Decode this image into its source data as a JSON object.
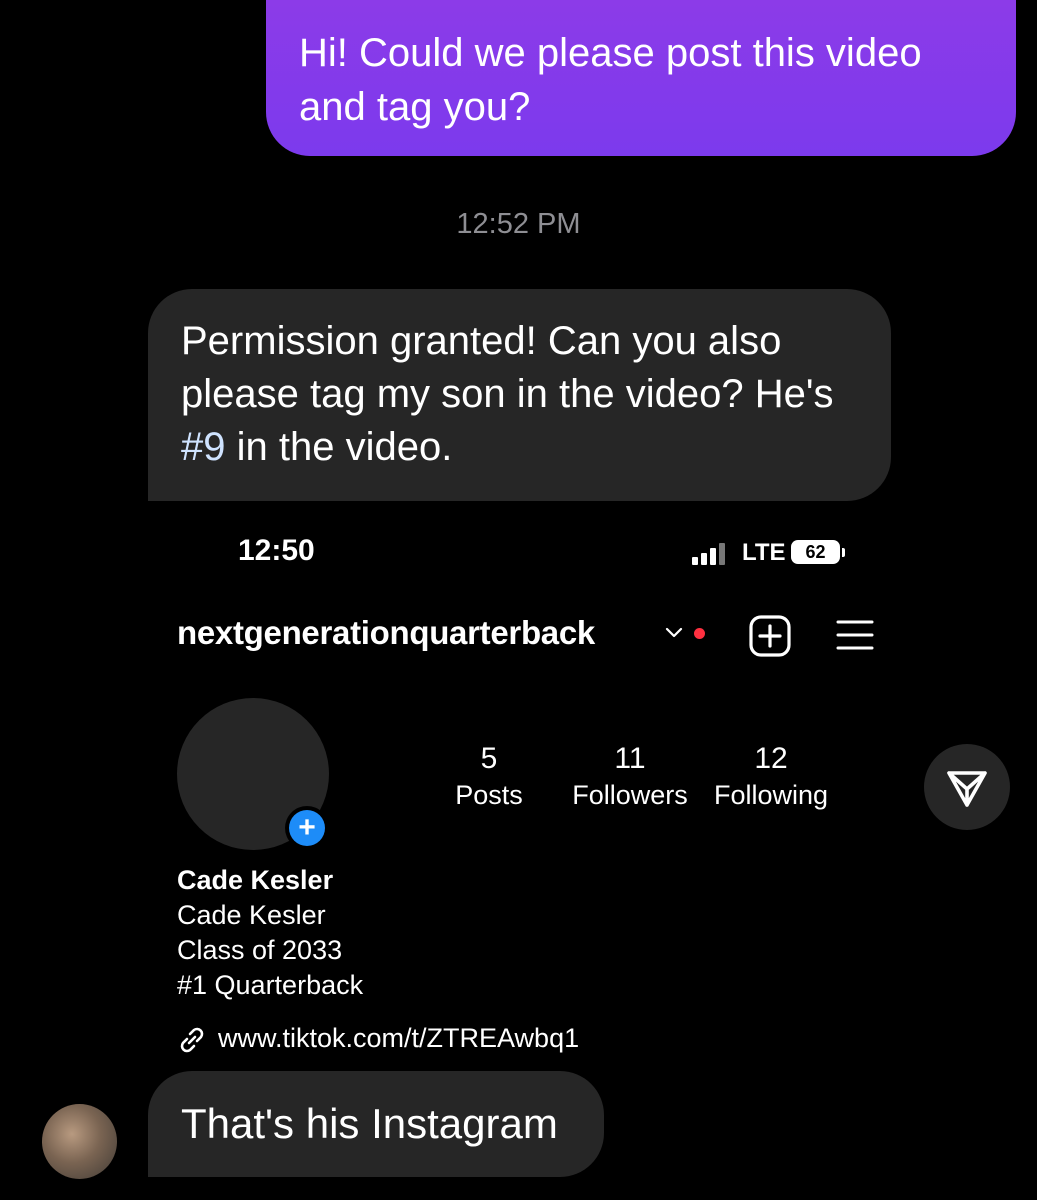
{
  "messages": {
    "outgoing": "Hi! Could we please post this video and tag you?",
    "timestamp": "12:52 PM",
    "incoming_parts": [
      "Permission granted!   Can you also please tag my son in the video? He's ",
      "#9",
      " in the video."
    ],
    "last": "That's his Instagram"
  },
  "shared_screenshot": {
    "status_time": "12:50",
    "network": "LTE",
    "battery": "62",
    "username": "nextgenerationquarterback",
    "stats": [
      {
        "value": "5",
        "label": "Posts"
      },
      {
        "value": "11",
        "label": "Followers"
      },
      {
        "value": "12",
        "label": "Following"
      }
    ],
    "profile_name": "Cade Kesler",
    "bio_lines": [
      "Cade Kesler",
      "Class of 2033",
      "#1 Quarterback"
    ],
    "link": "www.tiktok.com/t/ZTREAwbq1",
    "plus_badge": "+"
  },
  "icons": [
    "chevron-down-icon",
    "add-post-icon",
    "menu-icon",
    "share-icon",
    "link-icon"
  ],
  "colors": {
    "outgoing_bubble": "#8b3be7",
    "incoming_bubble": "#262626",
    "badge": "#1d8cf8",
    "notification_dot": "#ff3040"
  }
}
